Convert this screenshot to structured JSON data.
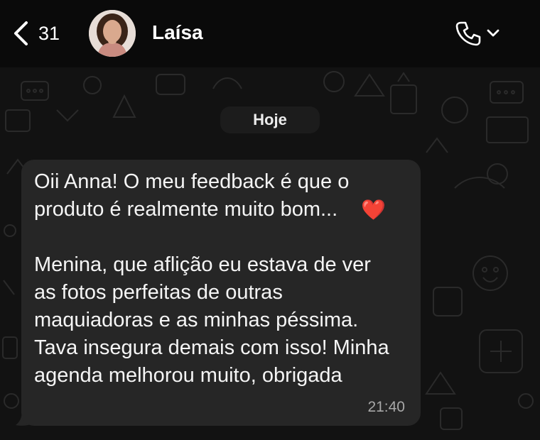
{
  "header": {
    "back_count": "31",
    "contact_name": "Laísa"
  },
  "chat": {
    "date_label": "Hoje",
    "message": {
      "text": "Oii Anna! O meu feedback é que o\nproduto é realmente muito bom...\n\nMenina, que aflição eu estava de ver\nas fotos perfeitas de outras\nmaquiadoras e as minhas péssima.\nTava insegura demais com isso! Minha\nagenda melhorou muito, obrigada",
      "emoji": "❤️",
      "time": "21:40"
    }
  },
  "colors": {
    "background": "#121212",
    "bubble": "#262626",
    "header": "#0a0a0a",
    "heart": "#e0303a"
  }
}
